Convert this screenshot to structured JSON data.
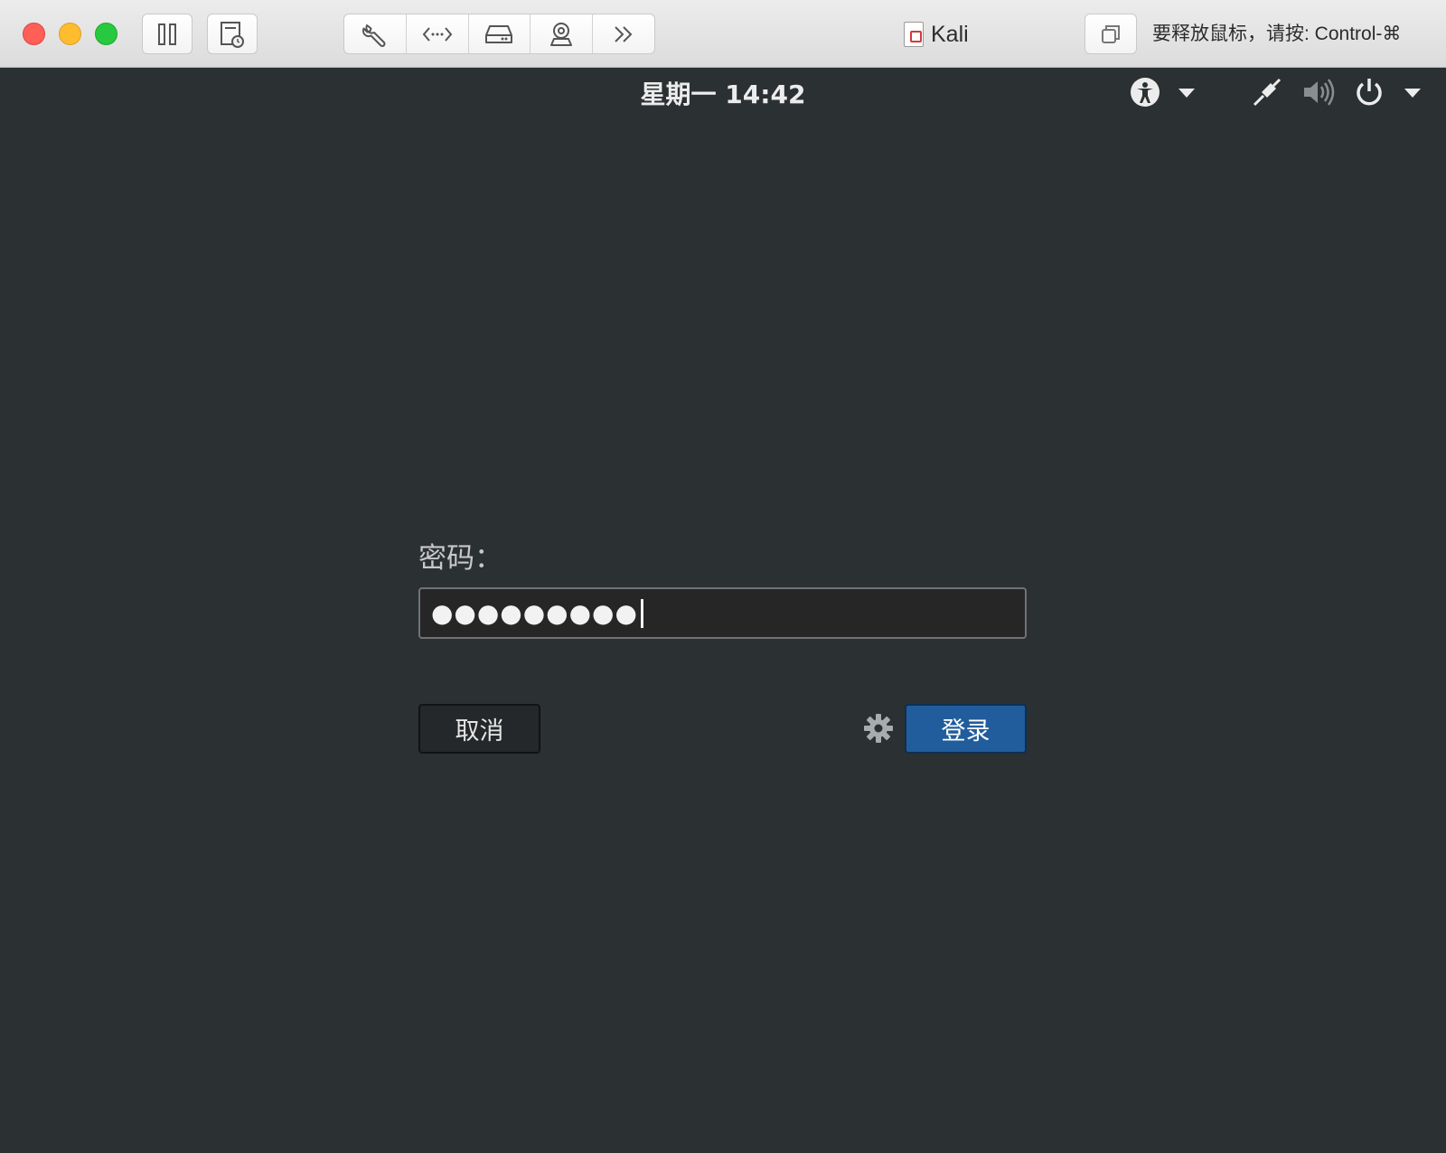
{
  "window": {
    "title": "Kali",
    "release_hint": "要释放鼠标，请按: Control-⌘",
    "toolbar_icons": [
      "pause-icon",
      "snapshot-icon",
      "wrench-icon",
      "code-arrows-icon",
      "hard-drive-icon",
      "camera-icon",
      "more-chevrons-icon",
      "window-copy-icon"
    ]
  },
  "topbar": {
    "clock": "星期一 14:42",
    "icons": [
      "accessibility-icon",
      "dropdown-arrow-icon",
      "network-wired-icon",
      "volume-icon",
      "power-icon",
      "dropdown-arrow-icon"
    ]
  },
  "login": {
    "password_label": "密码：",
    "password_mask": "●●●●●●●●●",
    "cancel_label": "取消",
    "login_label": "登录",
    "settings_icon": "gear-icon",
    "login_color": "#215d9c"
  }
}
